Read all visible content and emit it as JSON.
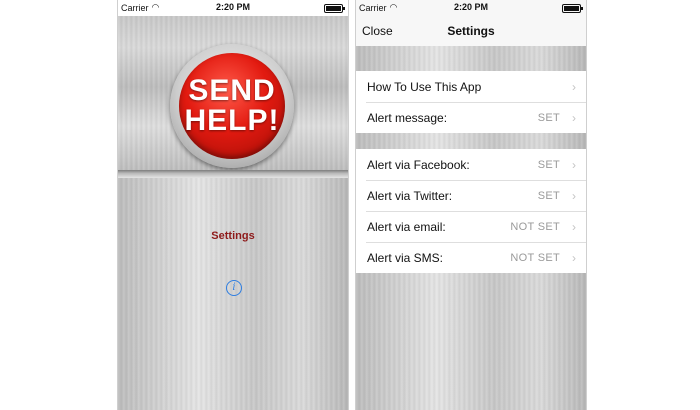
{
  "status_bar": {
    "carrier": "Carrier",
    "time": "2:20 PM"
  },
  "main_screen": {
    "button_line1": "SEND",
    "button_line2": "HELP!",
    "settings_link": "Settings",
    "info_icon": "info-icon"
  },
  "settings_screen": {
    "close_label": "Close",
    "title": "Settings",
    "group1": [
      {
        "label": "How To Use This App",
        "value": ""
      },
      {
        "label": "Alert message:",
        "value": "SET"
      }
    ],
    "group2": [
      {
        "label": "Alert via Facebook:",
        "value": "SET"
      },
      {
        "label": "Alert via Twitter:",
        "value": "SET"
      },
      {
        "label": "Alert via email:",
        "value": "NOT SET"
      },
      {
        "label": "Alert via SMS:",
        "value": "NOT SET"
      }
    ]
  },
  "colors": {
    "button_red": "#e21a10",
    "settings_link": "#8e1a1a",
    "info_blue": "#2f7ee0"
  }
}
